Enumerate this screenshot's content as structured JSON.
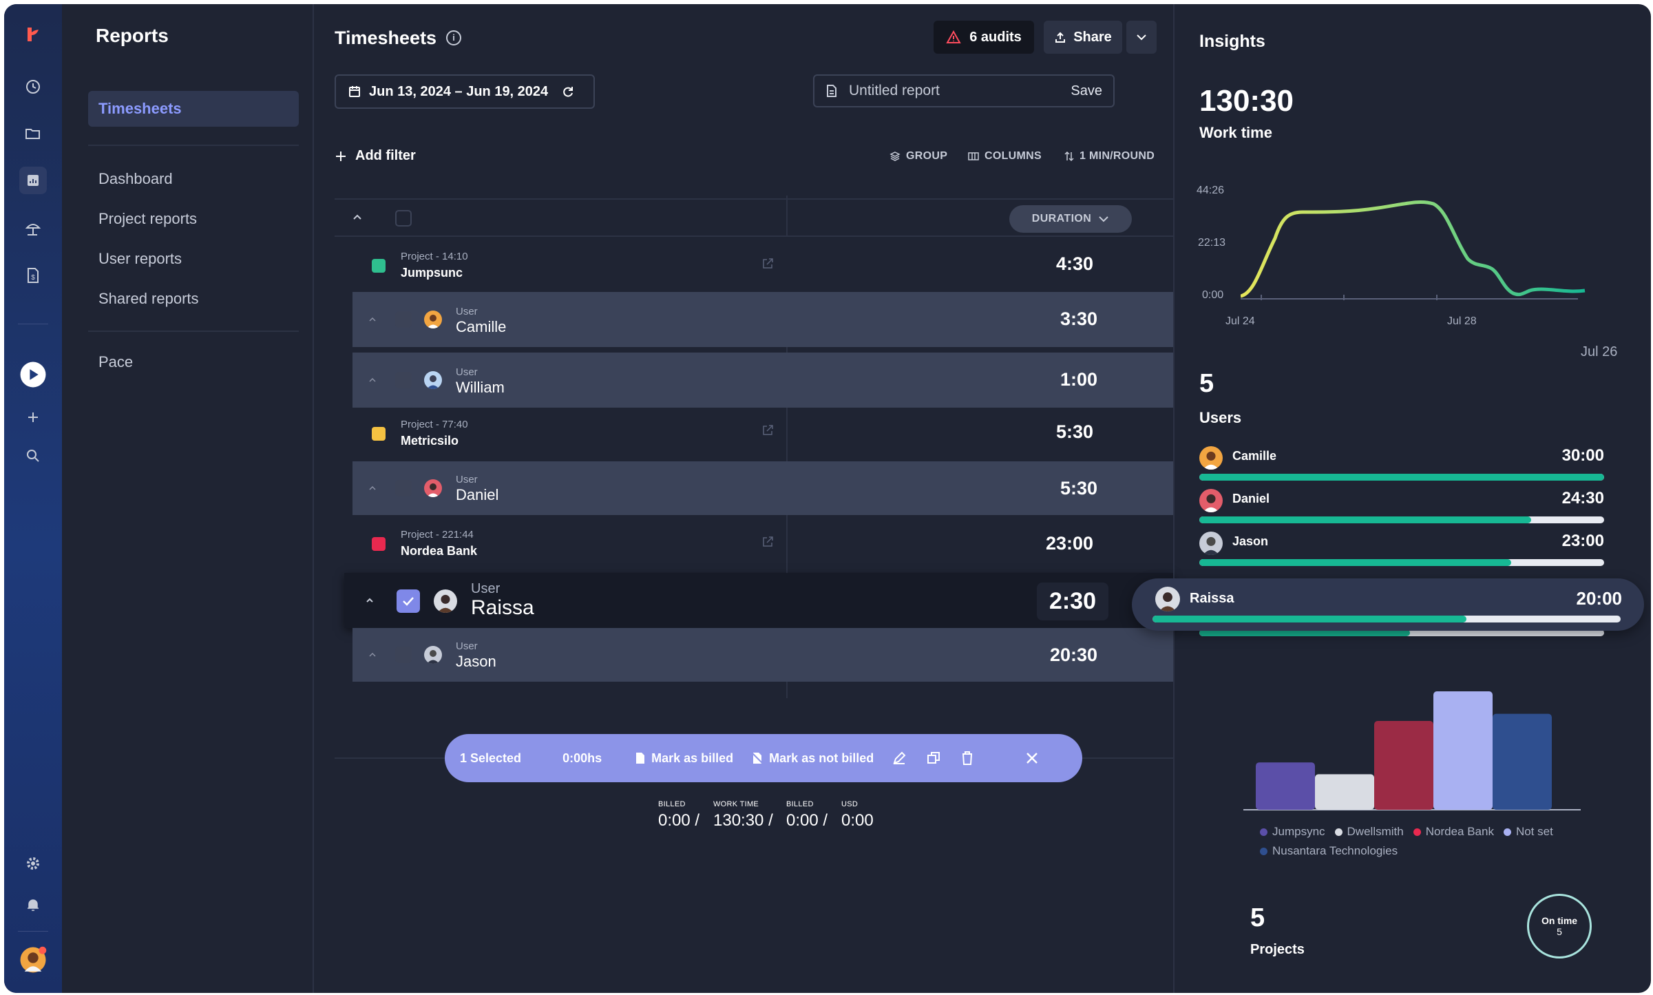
{
  "sidebar": {
    "section_title": "Reports",
    "items": [
      {
        "label": "Timesheets"
      },
      {
        "label": "Dashboard"
      },
      {
        "label": "Project reports"
      },
      {
        "label": "User reports"
      },
      {
        "label": "Shared reports"
      },
      {
        "label": "Pace"
      }
    ]
  },
  "header": {
    "title": "Timesheets",
    "audits_label": "6 audits",
    "share_label": "Share",
    "date_range": "Jun 13, 2024 – Jun 19, 2024",
    "report_placeholder": "Untitled report",
    "save_label": "Save"
  },
  "toolbar": {
    "add_filter": "Add filter",
    "group": "GROUP",
    "columns": "COLUMNS",
    "rounding": "1 MIN/ROUND"
  },
  "table": {
    "duration_header": "DURATION",
    "rows": [
      {
        "kind": "project",
        "label": "Project - 14:10",
        "name": "Jumpsunc",
        "duration": "4:30",
        "color": "#2fbf8f"
      },
      {
        "kind": "user",
        "label": "User",
        "name": "Camille",
        "duration": "3:30"
      },
      {
        "kind": "user",
        "label": "User",
        "name": "William",
        "duration": "1:00"
      },
      {
        "kind": "project",
        "label": "Project - 77:40",
        "name": "Metricsilo",
        "duration": "5:30",
        "color": "#f5c242"
      },
      {
        "kind": "user",
        "label": "User",
        "name": "Daniel",
        "duration": "5:30"
      },
      {
        "kind": "project",
        "label": "Project - 221:44",
        "name": "Nordea Bank",
        "duration": "23:00",
        "color": "#e8294f"
      },
      {
        "kind": "user",
        "label": "User",
        "name": "Raissa",
        "duration": "2:30"
      },
      {
        "kind": "user",
        "label": "User",
        "name": "Jason",
        "duration": "20:30"
      }
    ]
  },
  "selection_bar": {
    "count": "1 Selected",
    "hours": "0:00hs",
    "mark_billed": "Mark as billed",
    "mark_not_billed": "Mark as not billed"
  },
  "summary": [
    {
      "label": "BILLED",
      "value": "0:00 /"
    },
    {
      "label": "WORK TIME",
      "value": "130:30 /"
    },
    {
      "label": "BILLED",
      "value": "0:00 /"
    },
    {
      "label": "USD",
      "value": "0:00"
    }
  ],
  "insights": {
    "title": "Insights",
    "work_time_value": "130:30",
    "work_time_label": "Work time",
    "chart_y_ticks": [
      "44:26",
      "22:13",
      "0:00"
    ],
    "chart_x_ticks": [
      "Jul 24",
      "Jul 28"
    ],
    "chart_date": "Jul 26",
    "users_count": "5",
    "users_label": "Users",
    "users": [
      {
        "name": "Camille",
        "time": "30:00",
        "fill": 1.0
      },
      {
        "name": "Daniel",
        "time": "24:30",
        "fill": 0.82
      },
      {
        "name": "Jason",
        "time": "23:00",
        "fill": 0.77
      },
      {
        "name": "Raissa",
        "time": "20:00",
        "fill": 0.67
      },
      {
        "name": "",
        "time": "",
        "fill": 0.52
      }
    ],
    "projects_count": "5",
    "projects_label": "Projects",
    "on_time_label": "On time",
    "on_time_value": "5"
  },
  "chart_data": {
    "type": "bar",
    "categories": [
      "Jumpsync",
      "Dwellsmith",
      "Nordea Bank",
      "Not set",
      "Nusantara Technologies"
    ],
    "values": [
      40,
      30,
      75,
      100,
      81
    ],
    "colors": [
      "#5b4fa8",
      "#d9dce3",
      "#9b2b45",
      "#a9b1f2",
      "#2f4f8f"
    ],
    "legend": [
      "Jumpsync",
      "Dwellsmith",
      "Nordea Bank",
      "Not set",
      "Nusantara Technologies"
    ]
  },
  "line_chart": {
    "type": "line",
    "x_ticks": [
      "Jul 24",
      "Jul 28"
    ],
    "y_ticks": [
      "0:00",
      "22:13",
      "44:26"
    ]
  }
}
